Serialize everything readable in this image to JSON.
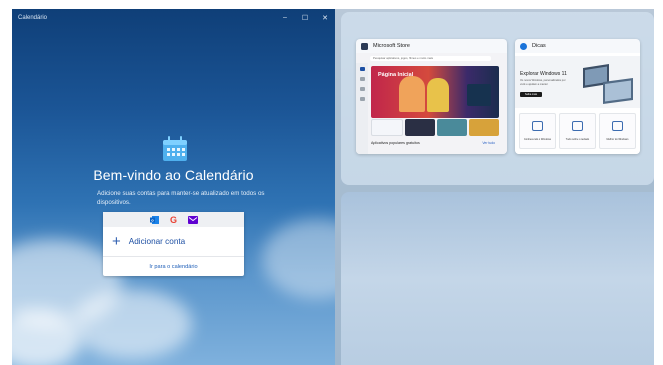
{
  "calendar": {
    "window_title": "Calendário",
    "controls": [
      "–",
      "☐",
      "✕"
    ],
    "welcome_title": "Bem-vindo ao Calendário",
    "welcome_subtitle": "Adicione suas contas para manter-se atualizado em todos os dispositivos.",
    "add_account_label": "Adicionar conta",
    "goto_calendar_label": "Ir para o calendário",
    "providers": [
      "outlook-icon",
      "google-icon",
      "yahoo-icon"
    ]
  },
  "snap": {
    "store": {
      "title": "Microsoft Store",
      "address": "Pesquisar aplicativos, jogos, filmes e muito mais",
      "hero_title": "Página Inicial",
      "popular_label": "Aplicativos populares gratuitos",
      "see_all": "Ver tudo"
    },
    "tips": {
      "title": "Dicas",
      "hero_title": "Explorar Windows 11",
      "hero_text": "Os novos Windows, personalizados por você e ajudam a manter",
      "hero_button": "Saiba mais",
      "tiles": [
        "Conhecendo o Windows",
        "Tudo sobre o teclado",
        "Melhor do Windows"
      ]
    }
  },
  "colors": {
    "accent": "#1d4fa3",
    "store_icon": "#2b3a55",
    "tips_icon": "#1a73d9",
    "google": "#ea4335",
    "yahoo": "#5f01d1",
    "outlook": "#0a64c8"
  }
}
